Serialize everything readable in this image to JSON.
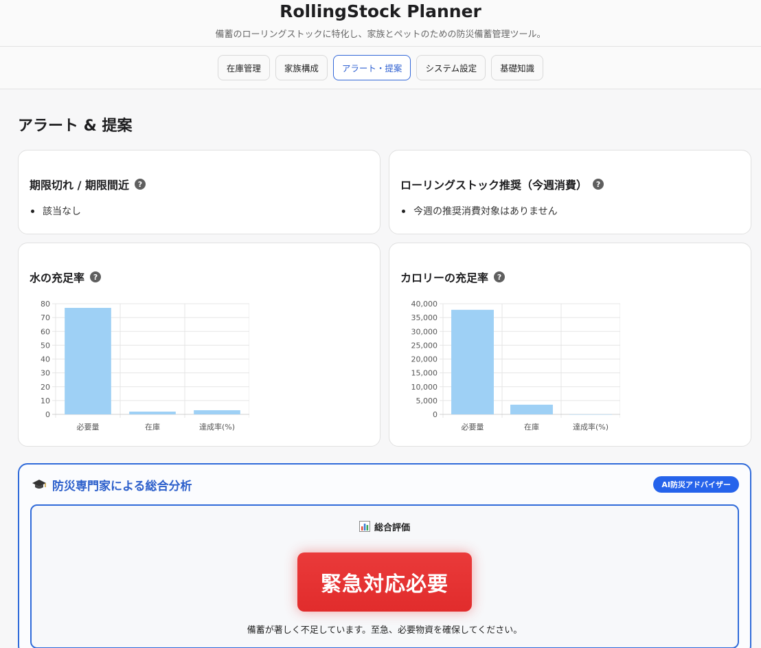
{
  "header": {
    "title": "RollingStock Planner",
    "subtitle": "備蓄のローリングストックに特化し、家族とペットのための防災備蓄管理ツール。"
  },
  "nav": {
    "tabs": [
      {
        "label": "在庫管理",
        "active": false
      },
      {
        "label": "家族構成",
        "active": false
      },
      {
        "label": "アラート・提案",
        "active": true
      },
      {
        "label": "システム設定",
        "active": false
      },
      {
        "label": "基礎知識",
        "active": false
      }
    ]
  },
  "section": {
    "title": "アラート & 提案"
  },
  "cards": {
    "expiry": {
      "title": "期限切れ / 期限間近",
      "items": [
        "該当なし"
      ]
    },
    "rolling": {
      "title": "ローリングストック推奨（今週消費）",
      "items": [
        "今週の推奨消費対象はありません"
      ]
    },
    "water": {
      "title": "水の充足率"
    },
    "calorie": {
      "title": "カロリーの充足率"
    }
  },
  "help_icon": "question-mark-icon",
  "colors": {
    "accent": "#2f6ad9",
    "bar": "#9ed0f5",
    "urgent": "#e33333",
    "badge": "#2563eb"
  },
  "chart_data": [
    {
      "type": "bar",
      "title": "水の充足率",
      "categories": [
        "必要量",
        "在庫",
        "達成率(%)"
      ],
      "values": [
        77,
        2,
        3
      ],
      "ylim": [
        0,
        80
      ],
      "yticks": [
        "0",
        "10",
        "20",
        "30",
        "40",
        "50",
        "60",
        "70",
        "80"
      ],
      "grid": true
    },
    {
      "type": "bar",
      "title": "カロリーの充足率",
      "categories": [
        "必要量",
        "在庫",
        "達成率(%)"
      ],
      "values": [
        37800,
        3500,
        10
      ],
      "ylim": [
        0,
        40000
      ],
      "yticks": [
        "0",
        "5,000",
        "10,000",
        "15,000",
        "20,000",
        "25,000",
        "30,000",
        "35,000",
        "40,000"
      ],
      "grid": true
    }
  ],
  "analysis": {
    "title": "防災専門家による総合分析",
    "title_icon": "graduation-cap-icon",
    "badge": "AI防災アドバイザー",
    "eval_label": "総合評価",
    "eval_icon": "bar-chart-icon",
    "status": "緊急対応必要",
    "message": "備蓄が著しく不足しています。至急、必要物資を確保してください。"
  }
}
